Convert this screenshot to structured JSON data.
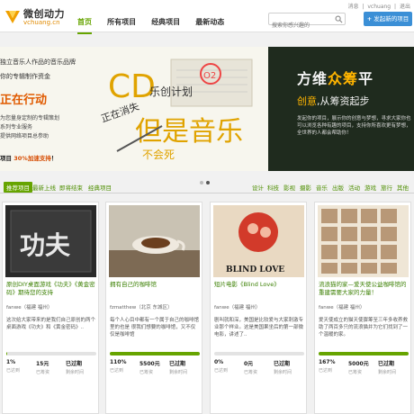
{
  "header": {
    "logo_cn": "微创动力",
    "logo_en": "vchuang.cn",
    "nav": [
      "首页",
      "所有项目",
      "经典项目",
      "最新动态"
    ],
    "toplinks": [
      "消息",
      "|",
      "vchuang",
      "|",
      "退出"
    ],
    "search_placeholder": "搜索你感兴趣的",
    "publish_label": "发起新的项目",
    "colors": {
      "accent": "#66a400",
      "publish": "#3b8fd6"
    }
  },
  "banner": {
    "left_lines": [
      "独立音乐人作品的音乐品牌",
      "你的专辑制作资金"
    ],
    "left_cta": "正在行动",
    "left_details": [
      "为您量身定制的专辑策划",
      "系列专业服务",
      "提供网络项目总参助"
    ],
    "left_promo_pre": "项目",
    "left_promo_hl": "30%加速支持",
    "left_promo_post": "！",
    "left_weibo": "了解更多详情请关注新浪微博@O2乐都",
    "art_cd": "CD",
    "art_plan": "乐创计划",
    "art_line": "正在消失",
    "art_music": "但是音乐",
    "art_never": "不会死",
    "art_o2": "O2",
    "right_title_a": "方维",
    "right_title_hl": "众筹",
    "right_title_b": "平",
    "right_sub_a": "创意",
    "right_sub_b": ",从筹资起步",
    "right_text": "发起你的项目，展示你的创意与梦想，寻求大家你也可以浏览各种有趣的项目，支持你所喜欢更有梦想，全世界的人都会帮助你！"
  },
  "filters": {
    "tabs": [
      "推荐项目",
      "最新上线",
      "即将结束",
      "经典项目"
    ],
    "categories": [
      "设计",
      "科技",
      "影视",
      "摄影",
      "音乐",
      "出版",
      "活动",
      "游戏",
      "旅行",
      "其他"
    ]
  },
  "cards": [
    {
      "title": "原创DIY桌面游戏《功夫》《黄金密码》期待您的支持",
      "author": "fanwe（福建 福州）",
      "desc": "这次给大家带来的是我们自己原创的两个桌面游戏《功夫》和《黄金密码》..",
      "progress": 1,
      "stat1": "1%",
      "stat1_k": "已达到",
      "stat2": "15元",
      "stat2_k": "已筹资",
      "stat3": "已过期",
      "stat3_k": "剩余时间",
      "thumb_text": "功夫"
    },
    {
      "title": "拥有自己的咖啡馆",
      "author": "fzmatthew（北京 东城区）",
      "desc": "每个人心目中都有一个属于自己的咖啡馆里的也是 很我们想要的咖啡馆，又不仅仅是咖啡馆",
      "progress": 100,
      "stat1": "110%",
      "stat1_k": "已达到",
      "stat2": "5500元",
      "stat2_k": "已筹资",
      "stat3": "已过期",
      "stat3_k": "剩余时间",
      "thumb_text": ""
    },
    {
      "title": "短片电影《Blind Love》",
      "author": "fanwe（福建 福州）",
      "desc": "剧叫就和深，美国是比较爱与大家刺激专业那个样业。这是美国果坐后的第一部微电影，讲述了..",
      "progress": 0,
      "stat1": "0%",
      "stat1_k": "已达到",
      "stat2": "0元",
      "stat2_k": "已筹资",
      "stat3": "已过期",
      "stat3_k": "剩余时间",
      "thumb_text": "BLIND LOVE"
    },
    {
      "title": "流浪猫的家—爱天使公益咖啡馆的重建需要大家的力量！",
      "author": "fanwe（福建 福州）",
      "desc": "爱天使成立的猫天使骤筹至三年多收养救助了两百多只的流浪猫并为它们找到了一个温暖的家。",
      "progress": 100,
      "stat1": "167%",
      "stat1_k": "已达到",
      "stat2": "5000元",
      "stat2_k": "已筹资",
      "stat3": "已过期",
      "stat3_k": "剩余时间",
      "thumb_text": ""
    }
  ]
}
